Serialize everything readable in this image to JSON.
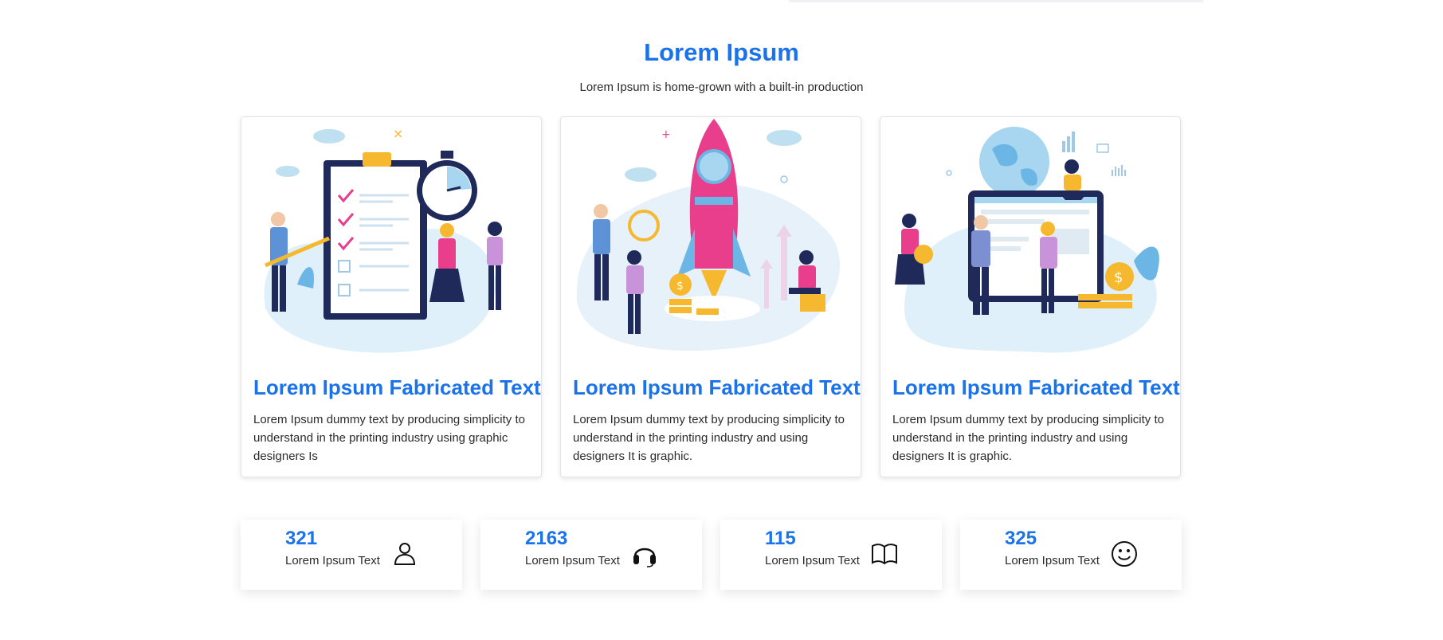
{
  "header": {
    "title": "Lorem Ipsum",
    "subtitle": "Lorem Ipsum is home-grown with a built-in production"
  },
  "cards": [
    {
      "title": "Lorem Ipsum Fabricated Text",
      "text": "Lorem Ipsum dummy text by producing simplicity to understand in the printing industry using graphic designers Is",
      "illustration": "checklist-stopwatch-illustration"
    },
    {
      "title": "Lorem Ipsum Fabricated Text",
      "text": "Lorem Ipsum dummy text by producing simplicity to understand in the printing industry and using designers It is graphic.",
      "illustration": "rocket-launch-illustration"
    },
    {
      "title": "Lorem Ipsum Fabricated Text",
      "text": "Lorem Ipsum dummy text by producing simplicity to understand in the printing industry and using designers It is graphic.",
      "illustration": "global-dashboard-illustration"
    }
  ],
  "stats": [
    {
      "value": "321",
      "label": "Lorem Ipsum Text",
      "icon": "user-icon"
    },
    {
      "value": "2163",
      "label": "Lorem Ipsum Text",
      "icon": "headphones-icon"
    },
    {
      "value": "115",
      "label": "Lorem Ipsum Text",
      "icon": "book-icon"
    },
    {
      "value": "325",
      "label": "Lorem Ipsum Text",
      "icon": "smiley-icon"
    }
  ],
  "colors": {
    "accent": "#1a73e8",
    "text": "#2b2b2b",
    "pink": "#e83e8c",
    "navy": "#1f2a5a",
    "light_blue": "#cfe8f5",
    "gold": "#f5b82e"
  }
}
